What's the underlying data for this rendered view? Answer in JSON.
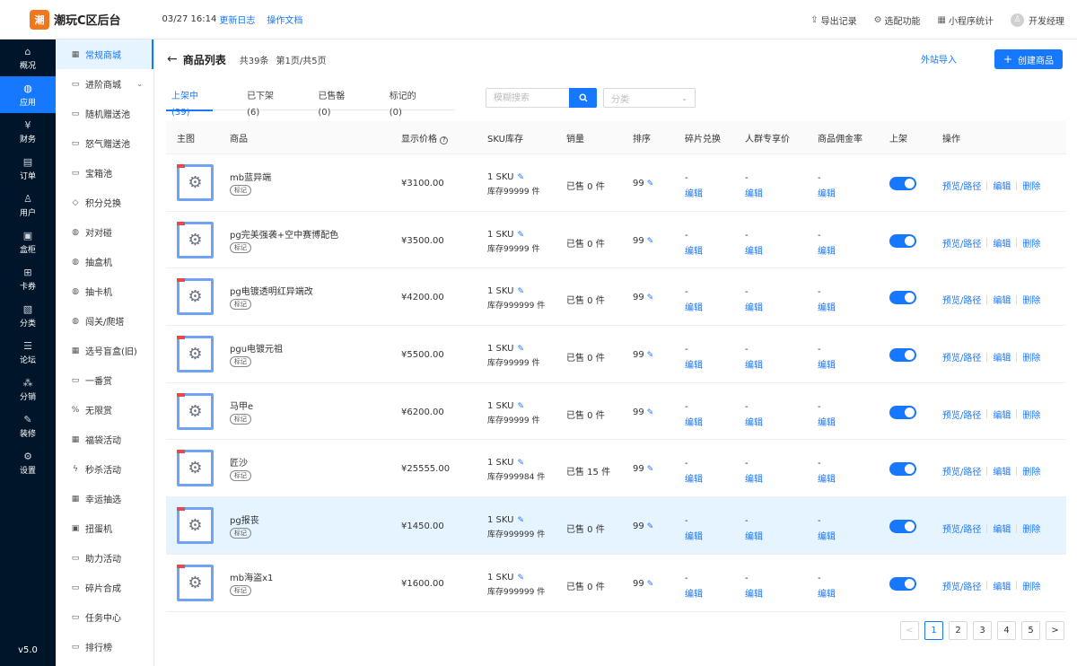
{
  "app": {
    "logo_glyph": "潮",
    "title": "潮玩C区后台",
    "datetime": "03/27 16:14",
    "changelog_link": "更新日志",
    "docs_link": "操作文档"
  },
  "top_actions": [
    {
      "icon": "export-icon",
      "glyph": "⇪",
      "label": "导出记录"
    },
    {
      "icon": "settings-icon",
      "glyph": "⚙",
      "label": "选配功能"
    },
    {
      "icon": "stats-icon",
      "glyph": "▦",
      "label": "小程序统计"
    }
  ],
  "user": {
    "name": "开发经理"
  },
  "rail": [
    {
      "label": "概况",
      "glyph": "⌂",
      "icon": "home-icon"
    },
    {
      "label": "应用",
      "glyph": "◍",
      "icon": "app-icon",
      "active": true
    },
    {
      "label": "财务",
      "glyph": "¥",
      "icon": "finance-icon"
    },
    {
      "label": "订单",
      "glyph": "▤",
      "icon": "order-icon"
    },
    {
      "label": "用户",
      "glyph": "♙",
      "icon": "user-icon"
    },
    {
      "label": "盒柜",
      "glyph": "▣",
      "icon": "box-icon"
    },
    {
      "label": "卡券",
      "glyph": "⊞",
      "icon": "coupon-icon"
    },
    {
      "label": "分类",
      "glyph": "▧",
      "icon": "category-icon"
    },
    {
      "label": "论坛",
      "glyph": "☰",
      "icon": "forum-icon"
    },
    {
      "label": "分销",
      "glyph": "⁂",
      "icon": "distribution-icon"
    },
    {
      "label": "装修",
      "glyph": "✎",
      "icon": "decorate-icon"
    },
    {
      "label": "设置",
      "glyph": "⚙",
      "icon": "settings-icon"
    }
  ],
  "version": "v5.0",
  "submenu": [
    {
      "label": "常规商城",
      "glyph": "▦",
      "active": true
    },
    {
      "label": "进阶商城",
      "glyph": "▭",
      "has_children": true
    },
    {
      "label": "随机赠送池",
      "glyph": "▭"
    },
    {
      "label": "怒气赠送池",
      "glyph": "▭"
    },
    {
      "label": "宝箱池",
      "glyph": "▭"
    },
    {
      "label": "积分兑换",
      "glyph": "◇"
    },
    {
      "label": "对对碰",
      "glyph": "◍"
    },
    {
      "label": "抽盒机",
      "glyph": "◍"
    },
    {
      "label": "抽卡机",
      "glyph": "◍"
    },
    {
      "label": "闯关/爬塔",
      "glyph": "◍"
    },
    {
      "label": "选号盲盒(旧)",
      "glyph": "▦"
    },
    {
      "label": "一番赏",
      "glyph": "▭"
    },
    {
      "label": "无限赏",
      "glyph": "%"
    },
    {
      "label": "福袋活动",
      "glyph": "▦"
    },
    {
      "label": "秒杀活动",
      "glyph": "ϟ"
    },
    {
      "label": "幸运抽选",
      "glyph": "▦"
    },
    {
      "label": "扭蛋机",
      "glyph": "▣"
    },
    {
      "label": "助力活动",
      "glyph": "▭"
    },
    {
      "label": "碎片合成",
      "glyph": "▭"
    },
    {
      "label": "任务中心",
      "glyph": "▭"
    },
    {
      "label": "排行榜",
      "glyph": "▭"
    }
  ],
  "page": {
    "title": "商品列表",
    "total": "共39条",
    "page_info": "第1页/共5页",
    "import_link": "外站导入",
    "create_button": "创建商品"
  },
  "tabs": [
    {
      "label": "上架中 (39)",
      "active": true
    },
    {
      "label": "已下架 (6)"
    },
    {
      "label": "已售罄 (0)"
    },
    {
      "label": "标记的 (0)"
    }
  ],
  "search": {
    "placeholder": "模糊搜索"
  },
  "category_select": {
    "placeholder": "分类"
  },
  "columns": [
    "主图",
    "商品",
    "显示价格",
    "SKU库存",
    "销量",
    "排序",
    "碎片兑换",
    "人群专享价",
    "商品佣金率",
    "上架",
    "操作"
  ],
  "row_mark_label": "标记",
  "row_ops": [
    "预览/路径",
    "编辑",
    "删除"
  ],
  "rows": [
    {
      "name": "mb蓝异端",
      "price": "¥3100.00",
      "sku": "1 SKU",
      "stock": "库存99999 件",
      "sales": "已售 0 件",
      "sort": "99",
      "frag": "-",
      "frag_edit": "编辑",
      "crowd": "-",
      "crowd_edit": "编辑",
      "comm": "-",
      "comm_edit": "编辑"
    },
    {
      "name": "pg完美强袭+空中赛博配色",
      "price": "¥3500.00",
      "sku": "1 SKU",
      "stock": "库存99999 件",
      "sales": "已售 0 件",
      "sort": "99",
      "frag": "-",
      "frag_edit": "编辑",
      "crowd": "-",
      "crowd_edit": "编辑",
      "comm": "-",
      "comm_edit": "编辑"
    },
    {
      "name": "pg电镀透明红异端改",
      "price": "¥4200.00",
      "sku": "1 SKU",
      "stock": "库存999999 件",
      "sales": "已售 0 件",
      "sort": "99",
      "frag": "-",
      "frag_edit": "编辑",
      "crowd": "-",
      "crowd_edit": "编辑",
      "comm": "-",
      "comm_edit": "编辑"
    },
    {
      "name": "pgu电镀元祖",
      "price": "¥5500.00",
      "sku": "1 SKU",
      "stock": "库存99999 件",
      "sales": "已售 0 件",
      "sort": "99",
      "frag": "-",
      "frag_edit": "编辑",
      "crowd": "-",
      "crowd_edit": "编辑",
      "comm": "-",
      "comm_edit": "编辑"
    },
    {
      "name": "马甲e",
      "price": "¥6200.00",
      "sku": "1 SKU",
      "stock": "库存99999 件",
      "sales": "已售 0 件",
      "sort": "99",
      "frag": "-",
      "frag_edit": "编辑",
      "crowd": "-",
      "crowd_edit": "编辑",
      "comm": "-",
      "comm_edit": "编辑"
    },
    {
      "name": "匠沙",
      "price": "¥25555.00",
      "sku": "1 SKU",
      "stock": "库存999984 件",
      "sales": "已售 15 件",
      "sort": "99",
      "frag": "-",
      "frag_edit": "编辑",
      "crowd": "-",
      "crowd_edit": "编辑",
      "comm": "-",
      "comm_edit": "编辑"
    },
    {
      "name": "pg报丧",
      "price": "¥1450.00",
      "sku": "1 SKU",
      "stock": "库存999999 件",
      "sales": "已售 0 件",
      "sort": "99",
      "frag": "-",
      "frag_edit": "编辑",
      "crowd": "-",
      "crowd_edit": "编辑",
      "comm": "-",
      "comm_edit": "编辑",
      "highlight": true
    },
    {
      "name": "mb海盗x1",
      "price": "¥1600.00",
      "sku": "1 SKU",
      "stock": "库存999999 件",
      "sales": "已售 0 件",
      "sort": "99",
      "frag": "-",
      "frag_edit": "编辑",
      "crowd": "-",
      "crowd_edit": "编辑",
      "comm": "-",
      "comm_edit": "编辑"
    }
  ],
  "pagination": {
    "prev": "<",
    "pages": [
      "1",
      "2",
      "3",
      "4",
      "5"
    ],
    "current": "1",
    "next": ">"
  }
}
